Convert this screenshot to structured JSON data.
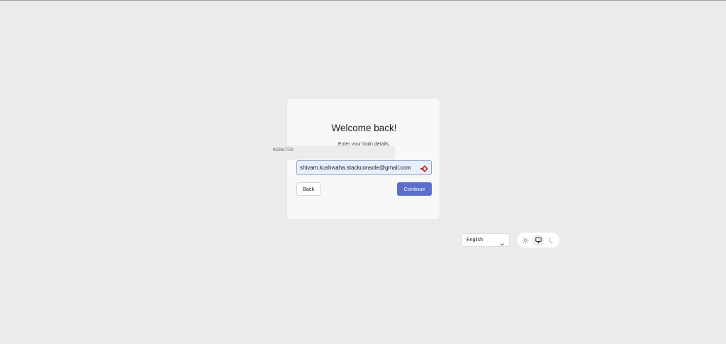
{
  "login": {
    "title": "Welcome back!",
    "subtitle": "Enter your login details.",
    "email_value": "shivam.kushwaha.stackconsole@gmail.com",
    "back_label": "Back",
    "continue_label": "Continue"
  },
  "redaction": {
    "label": "REDACTED"
  },
  "footer": {
    "language": "English",
    "theme_options": [
      "light",
      "system",
      "dark"
    ],
    "active_theme": "system"
  },
  "colors": {
    "background": "#ebebeb",
    "card": "#f8f8f8",
    "primary": "#5b6dcd",
    "autofill_field": "#e8effc",
    "autofill_icon": "#d0342c"
  },
  "icons": {
    "field_icon": "password-manager-icon",
    "language_chevron": "chevron-down-icon",
    "theme_light": "sun-icon",
    "theme_system": "monitor-icon",
    "theme_dark": "moon-icon"
  }
}
